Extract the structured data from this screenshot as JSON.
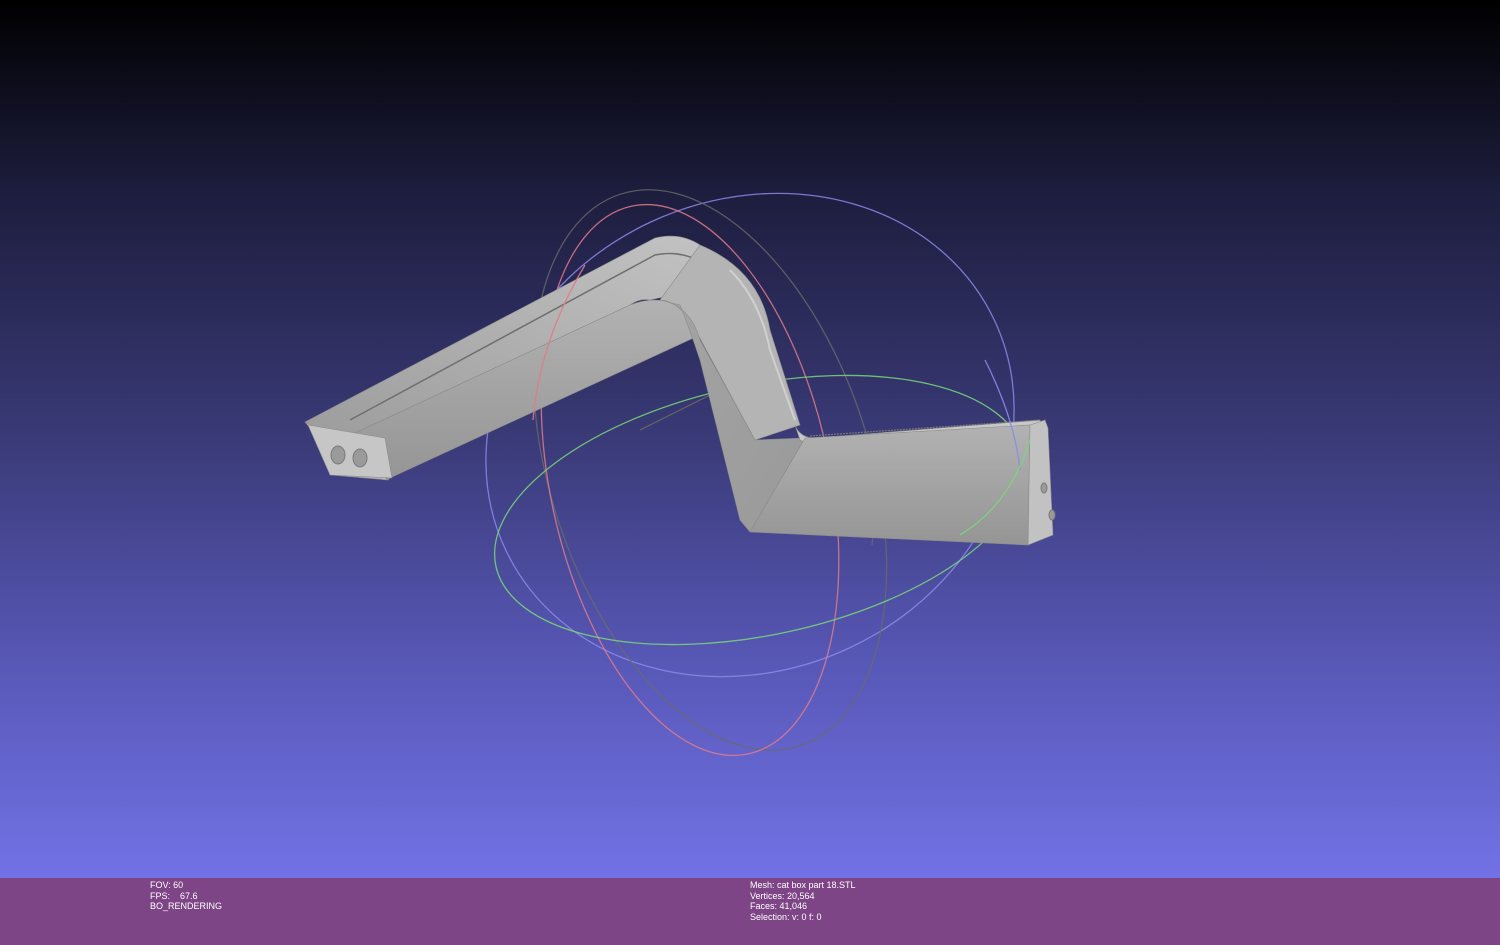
{
  "viewport": {
    "background_top": "#000000",
    "background_bottom": "#7272e6",
    "model_color": "#a9a9a9",
    "trackball_colors": {
      "x_ring": "#e07a8a",
      "y_ring": "#79d879",
      "z_ring": "#8a8aea",
      "neutral": "#6a6a6a"
    }
  },
  "status": {
    "background": "#7d4585",
    "left": {
      "fov": "FOV: 60",
      "fps": "FPS:    67.6",
      "mode": "BO_RENDERING"
    },
    "right": {
      "mesh": "Mesh: cat box part 18.STL",
      "vertices": "Vertices: 20,564",
      "faces": "Faces: 41,046",
      "selection": "Selection: v: 0 f: 0"
    }
  }
}
